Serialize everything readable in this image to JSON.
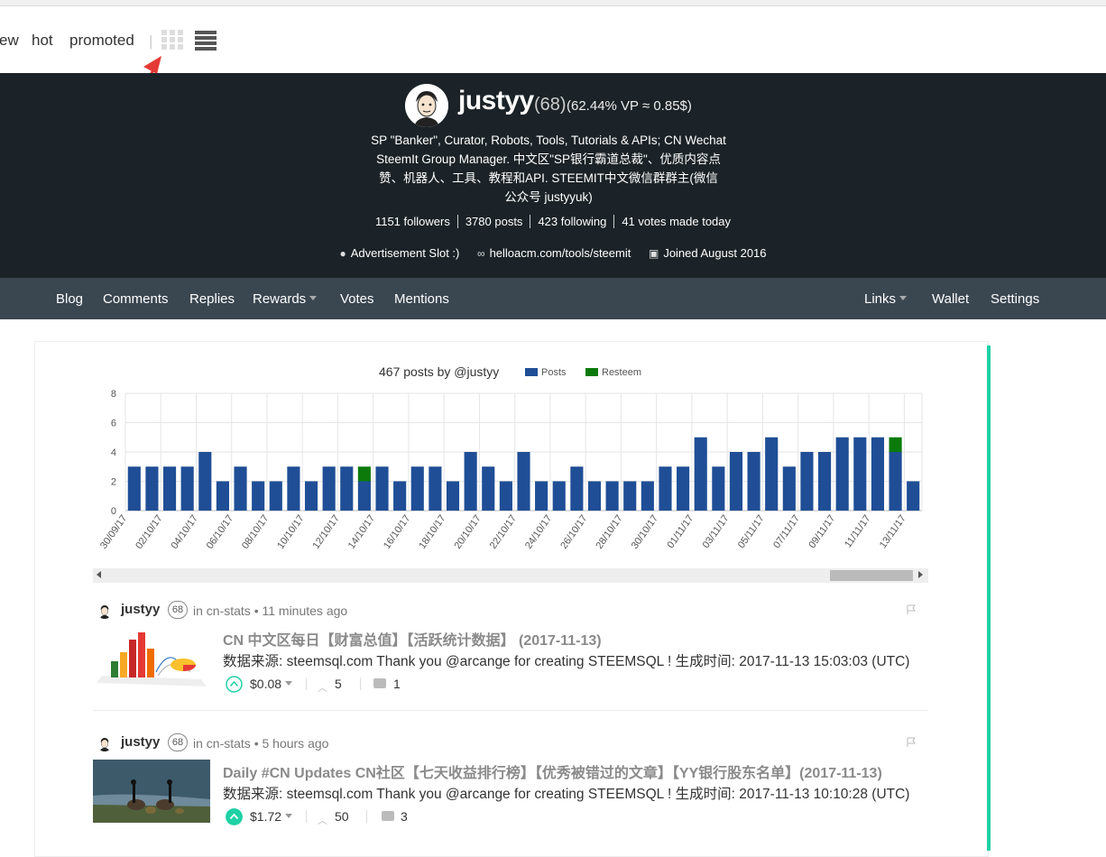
{
  "top_nav": {
    "tabs": [
      "ew",
      "hot",
      "promoted"
    ],
    "separator": "|"
  },
  "profile": {
    "username": "justyy",
    "reputation": "(68)",
    "voting_power": "(62.44% VP ≈ 0.85$)",
    "about_lines": [
      "SP \"Banker\", Curator, Robots, Tools, Tutorials & APIs; CN Wechat",
      "SteemIt Group Manager. 中文区\"SP银行霸道总裁\"、优质内容点",
      "赞、机器人、工具、教程和API. STEEMIT中文微信群群主(微信",
      "公众号 justyyuk)"
    ],
    "stats": [
      "1151 followers",
      "3780 posts",
      "423 following",
      "41 votes made today"
    ],
    "location": "Advertisement Slot :)",
    "website": "helloacm.com/tools/steemit",
    "joined": "Joined August 2016"
  },
  "sub_nav": {
    "left": [
      "Blog",
      "Comments",
      "Replies",
      "Rewards",
      "Votes",
      "Mentions"
    ],
    "right": [
      "Links",
      "Wallet",
      "Settings"
    ]
  },
  "chart_data": {
    "type": "bar",
    "title": "467 posts by @justyy",
    "legend": [
      "Posts",
      "Resteem"
    ],
    "legend_position": "top",
    "colors": {
      "posts": "#1f4e96",
      "resteem": "#0b7a0b"
    },
    "ylim": [
      0,
      8
    ],
    "yticks": [
      0,
      2,
      4,
      6,
      8
    ],
    "grid": true,
    "tick_labels": [
      "30/09/17",
      "02/10/17",
      "04/10/17",
      "06/10/17",
      "08/10/17",
      "10/10/17",
      "12/10/17",
      "14/10/17",
      "16/10/17",
      "18/10/17",
      "20/10/17",
      "22/10/17",
      "24/10/17",
      "26/10/17",
      "28/10/17",
      "30/10/17",
      "01/11/17",
      "03/11/17",
      "05/11/17",
      "07/11/17",
      "09/11/17",
      "11/11/17",
      "13/11/17"
    ],
    "series": [
      {
        "name": "Posts",
        "values": [
          3,
          3,
          3,
          3,
          4,
          2,
          3,
          2,
          2,
          3,
          2,
          3,
          3,
          2,
          3,
          2,
          3,
          3,
          2,
          4,
          3,
          2,
          4,
          2,
          2,
          3,
          2,
          2,
          2,
          2,
          3,
          3,
          5,
          3,
          4,
          4,
          5,
          3,
          4,
          4,
          5,
          5,
          5,
          4,
          2
        ]
      },
      {
        "name": "Resteem",
        "values": [
          0,
          0,
          0,
          0,
          0,
          0,
          0,
          0,
          0,
          0,
          0,
          0,
          0,
          1,
          0,
          0,
          0,
          0,
          0,
          0,
          0,
          0,
          0,
          0,
          0,
          0,
          0,
          0,
          0,
          0,
          0,
          0,
          0,
          0,
          0,
          0,
          0,
          0,
          0,
          0,
          0,
          0,
          0,
          1,
          0
        ]
      }
    ]
  },
  "posts": [
    {
      "author": "justyy",
      "reputation": "68",
      "category": "in cn-stats • 11 minutes ago",
      "title": "CN 中文区每日【财富总值】【活跃统计数据】 (2017-11-13)",
      "body": "数据来源: steemsql.com Thank you @arcange for creating STEEMSQL ! 生成时间: 2017-11-13 15:03:03 (UTC)",
      "payout": "$0.08",
      "votes": "5",
      "comments": "1",
      "voted": false
    },
    {
      "author": "justyy",
      "reputation": "68",
      "category": "in cn-stats • 5 hours ago",
      "title": "Daily #CN Updates CN社区【七天收益排行榜】【优秀被错过的文章】【YY银行股东名单】(2017-11-13)",
      "body": "数据来源: steemsql.com Thank you @arcange for creating STEEMSQL ! 生成时间: 2017-11-13 10:10:28 (UTC)",
      "payout": "$1.72",
      "votes": "50",
      "comments": "3",
      "voted": true
    }
  ],
  "colors": {
    "accent": "#1fd1a5",
    "hero_bg": "#1b2328",
    "subnav_bg": "#3a4650",
    "annotation_arrow": "#e53935"
  },
  "icons": [
    "grid-view-icon",
    "list-view-icon",
    "location-icon",
    "link-icon",
    "calendar-icon",
    "upvote-icon",
    "comment-icon",
    "flag-icon"
  ]
}
